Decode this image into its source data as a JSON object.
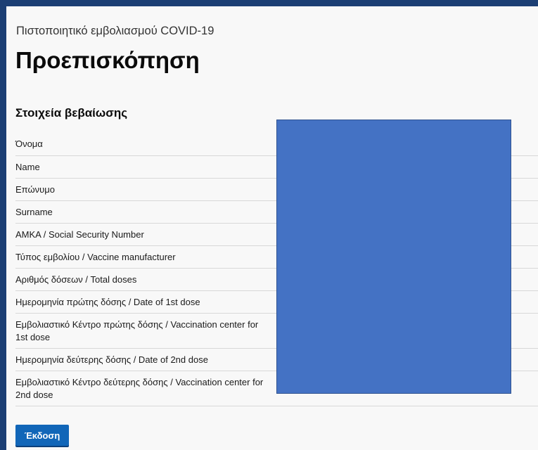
{
  "page": {
    "kicker": "Πιστοποιητικό εμβολιασμού COVID-19",
    "title": "Προεπισκόπηση"
  },
  "section": {
    "heading": "Στοιχεία βεβαίωσης",
    "fields": [
      {
        "label": "Όνομα"
      },
      {
        "label": "Name"
      },
      {
        "label": "Επώνυμο"
      },
      {
        "label": "Surname"
      },
      {
        "label": "ΑΜΚΑ / Social Security Number"
      },
      {
        "label": "Τύπος εμβολίου / Vaccine manufacturer"
      },
      {
        "label": "Αριθμός δόσεων / Total doses"
      },
      {
        "label": "Ημερομηνία πρώτης δόσης / Date of 1st dose"
      },
      {
        "label": "Εμβολιαστικό Κέντρο πρώτης δόσης / Vaccination center for 1st dose"
      },
      {
        "label": "Ημερομηνία δεύτερης δόσης / Date of 2nd dose"
      },
      {
        "label": "Εμβολιαστικό Κέντρο δεύτερης δόσης / Vaccination center for 2nd dose"
      }
    ]
  },
  "actions": {
    "issue_label": "Έκδοση"
  },
  "colors": {
    "frame": "#1c3f74",
    "redaction": "#4472c4",
    "primary_button": "#1166b8"
  }
}
